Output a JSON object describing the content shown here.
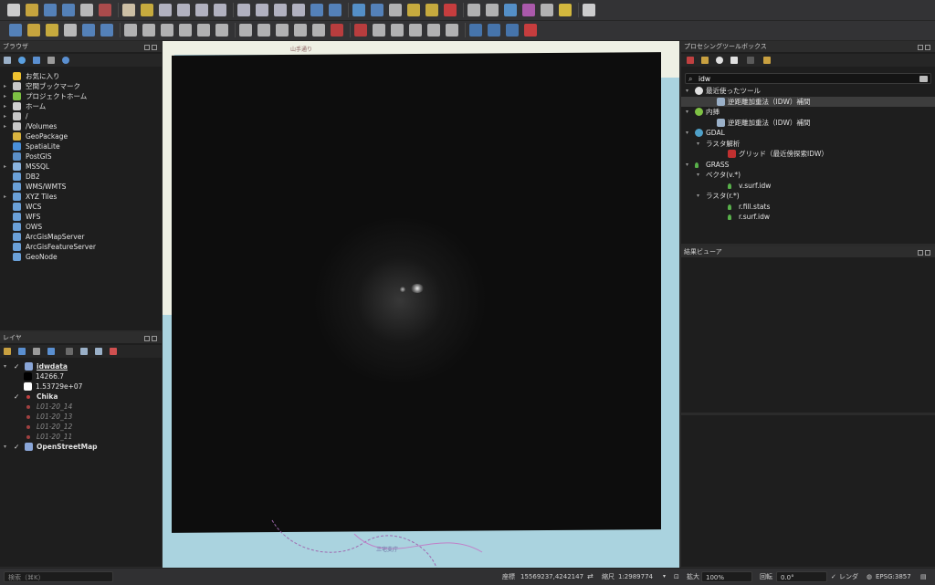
{
  "browser": {
    "title": "ブラウザ",
    "items": [
      {
        "label": "お気に入り",
        "icon": "star-icon",
        "color": "#f0c330",
        "arrow": ""
      },
      {
        "label": "空間ブックマーク",
        "icon": "bookmark-icon",
        "color": "#c8c8c8",
        "arrow": "▸"
      },
      {
        "label": "プロジェクトホーム",
        "icon": "project-home-icon",
        "color": "#7ec144",
        "arrow": "▸"
      },
      {
        "label": "ホーム",
        "icon": "home-icon",
        "color": "#d0d0d0",
        "arrow": "▸"
      },
      {
        "label": "/",
        "icon": "folder-icon",
        "color": "#c8c8c8",
        "arrow": "▸"
      },
      {
        "label": "/Volumes",
        "icon": "folder-icon",
        "color": "#c8c8c8",
        "arrow": "▸"
      },
      {
        "label": "GeoPackage",
        "icon": "geopackage-icon",
        "color": "#d9b440",
        "arrow": ""
      },
      {
        "label": "SpatiaLite",
        "icon": "spatialite-icon",
        "color": "#4a90d9",
        "arrow": ""
      },
      {
        "label": "PostGIS",
        "icon": "postgis-icon",
        "color": "#5b8fc7",
        "arrow": ""
      },
      {
        "label": "MSSQL",
        "icon": "mssql-icon",
        "color": "#8ab4e0",
        "arrow": "▸"
      },
      {
        "label": "DB2",
        "icon": "db2-icon",
        "color": "#6aa0d8",
        "arrow": ""
      },
      {
        "label": "WMS/WMTS",
        "icon": "wms-icon",
        "color": "#6aa0d8",
        "arrow": ""
      },
      {
        "label": "XYZ Tiles",
        "icon": "xyz-tiles-icon",
        "color": "#6aa0d8",
        "arrow": "▸"
      },
      {
        "label": "WCS",
        "icon": "wcs-icon",
        "color": "#6aa0d8",
        "arrow": ""
      },
      {
        "label": "WFS",
        "icon": "wfs-icon",
        "color": "#6aa0d8",
        "arrow": ""
      },
      {
        "label": "OWS",
        "icon": "ows-icon",
        "color": "#6aa0d8",
        "arrow": ""
      },
      {
        "label": "ArcGisMapServer",
        "icon": "arcgis-map-icon",
        "color": "#6aa0d8",
        "arrow": ""
      },
      {
        "label": "ArcGisFeatureServer",
        "icon": "arcgis-feature-icon",
        "color": "#6aa0d8",
        "arrow": ""
      },
      {
        "label": "GeoNode",
        "icon": "geonode-icon",
        "color": "#6aa0d8",
        "arrow": ""
      }
    ]
  },
  "layers": {
    "title": "レイヤ",
    "items": [
      {
        "label": "idwdata",
        "check": "✓",
        "arrow": "▾",
        "icon": "raster-layer-icon",
        "color": "#8aa6d8",
        "style": "bold-underline",
        "indent": 0
      },
      {
        "label": "14266.7",
        "check": "",
        "arrow": "",
        "icon": "black-swatch",
        "color": "#000000",
        "style": "normal",
        "indent": 1
      },
      {
        "label": "1.53729e+07",
        "check": "",
        "arrow": "",
        "icon": "white-swatch",
        "color": "#ffffff",
        "style": "normal",
        "indent": 1
      },
      {
        "label": "Chika",
        "check": "✓",
        "arrow": "",
        "icon": "point-layer-icon",
        "color": "#c04040",
        "style": "bold",
        "indent": 0
      },
      {
        "label": "L01-20_14",
        "check": "",
        "arrow": "",
        "icon": "point-layer-icon",
        "color": "#a04040",
        "style": "dim",
        "indent": 0
      },
      {
        "label": "L01-20_13",
        "check": "",
        "arrow": "",
        "icon": "point-layer-icon",
        "color": "#a04040",
        "style": "dim",
        "indent": 0
      },
      {
        "label": "L01-20_12",
        "check": "",
        "arrow": "",
        "icon": "point-layer-icon",
        "color": "#a04040",
        "style": "dim",
        "indent": 0
      },
      {
        "label": "L01-20_11",
        "check": "",
        "arrow": "",
        "icon": "point-layer-icon",
        "color": "#a04040",
        "style": "dim",
        "indent": 0
      },
      {
        "label": "OpenStreetMap",
        "check": "✓",
        "arrow": "▾",
        "icon": "xyz-tiles-icon",
        "color": "#8aa6d8",
        "style": "bold",
        "indent": 0
      }
    ]
  },
  "processing": {
    "title": "プロセシングツールボックス",
    "search_value": "idw",
    "tree": [
      {
        "label": "最近使ったツール",
        "arrow": "▾",
        "icon": "clock-icon",
        "color": "#e0e0e0",
        "indent": 0,
        "selected": false
      },
      {
        "label": "逆距離加重法（IDW）補間",
        "arrow": "",
        "icon": "idw-tool-icon",
        "color": "#9ab0c8",
        "indent": 2,
        "selected": true
      },
      {
        "label": "内挿",
        "arrow": "▾",
        "icon": "qgis-icon",
        "color": "#7ec144",
        "indent": 0,
        "selected": false
      },
      {
        "label": "逆距離加重法（IDW）補間",
        "arrow": "",
        "icon": "idw-tool-icon",
        "color": "#9ab0c8",
        "indent": 2,
        "selected": false
      },
      {
        "label": "GDAL",
        "arrow": "▾",
        "icon": "gdal-icon",
        "color": "#4fa0c8",
        "indent": 0,
        "selected": false
      },
      {
        "label": "ラスタ解析",
        "arrow": "▾",
        "icon": "",
        "color": "",
        "indent": 1,
        "selected": false
      },
      {
        "label": "グリッド（最近傍探索IDW）",
        "arrow": "",
        "icon": "gdal-grid-icon",
        "color": "#c03030",
        "indent": 3,
        "selected": false
      },
      {
        "label": "GRASS",
        "arrow": "▾",
        "icon": "grass-icon",
        "color": "#58b04a",
        "indent": 0,
        "selected": false
      },
      {
        "label": "ベクタ(v.*)",
        "arrow": "▾",
        "icon": "",
        "color": "",
        "indent": 1,
        "selected": false
      },
      {
        "label": "v.surf.idw",
        "arrow": "",
        "icon": "grass-icon",
        "color": "#58b04a",
        "indent": 3,
        "selected": false
      },
      {
        "label": "ラスタ(r.*)",
        "arrow": "▾",
        "icon": "",
        "color": "",
        "indent": 1,
        "selected": false
      },
      {
        "label": "r.fill.stats",
        "arrow": "",
        "icon": "grass-icon",
        "color": "#58b04a",
        "indent": 3,
        "selected": false
      },
      {
        "label": "r.surf.idw",
        "arrow": "",
        "icon": "grass-icon",
        "color": "#58b04a",
        "indent": 3,
        "selected": false
      }
    ]
  },
  "results": {
    "title": "結果ビューア"
  },
  "map": {
    "labels": {
      "top": "山手通り",
      "bottom": "三宅支庁"
    }
  },
  "statusbar": {
    "search_placeholder": "検索（⌘K）",
    "coordinate_label": "座標",
    "coordinate_value": "15569237,4242147",
    "scale_label": "縮尺",
    "scale_value": "1:2989774",
    "magnifier_label": "拡大",
    "magnifier_value": "100%",
    "rotation_label": "回転",
    "rotation_value": "0.0°",
    "render_label": "レンダ",
    "crs_label": "EPSG:3857"
  },
  "toolbar": {
    "row1_icons": [
      {
        "name": "new-project-icon",
        "color": "#e8e8e8"
      },
      {
        "name": "open-project-icon",
        "color": "#e0b840"
      },
      {
        "name": "save-project-icon",
        "color": "#5a8fd0"
      },
      {
        "name": "save-as-icon",
        "color": "#5a8fd0"
      },
      {
        "name": "print-layout-icon",
        "color": "#d0d0d0"
      },
      {
        "name": "style-manager-icon",
        "color": "#c05050"
      },
      {
        "name": "pan-icon",
        "color": "#e8d8b8"
      },
      {
        "name": "pan-to-selection-icon",
        "color": "#e0c040"
      },
      {
        "name": "zoom-in-icon",
        "color": "#c8c8d8"
      },
      {
        "name": "zoom-out-icon",
        "color": "#c8c8d8"
      },
      {
        "name": "zoom-full-icon",
        "color": "#c8c8d8"
      },
      {
        "name": "zoom-selection-icon",
        "color": "#c8c8d8"
      },
      {
        "name": "zoom-layer-icon",
        "color": "#c8c8d8"
      },
      {
        "name": "zoom-native-icon",
        "color": "#c8c8d8"
      },
      {
        "name": "zoom-last-icon",
        "color": "#c8c8d8"
      },
      {
        "name": "zoom-next-icon",
        "color": "#c8c8d8"
      },
      {
        "name": "new-map-view-icon",
        "color": "#5a8fd0"
      },
      {
        "name": "temporal-icon",
        "color": "#5a8fd0"
      },
      {
        "name": "refresh-icon",
        "color": "#5aa0e0"
      },
      {
        "name": "identify-icon",
        "color": "#5a8fd0"
      },
      {
        "name": "actions-icon",
        "color": "#c8c8c8"
      },
      {
        "name": "select-features-icon",
        "color": "#e0c040"
      },
      {
        "name": "select-value-icon",
        "color": "#e0c040"
      },
      {
        "name": "deselect-icon",
        "color": "#e04040"
      },
      {
        "name": "attribute-table-icon",
        "color": "#c8c8c8"
      },
      {
        "name": "field-calc-icon",
        "color": "#c8c8c8"
      },
      {
        "name": "processing-gear-icon",
        "color": "#5aa0e0"
      },
      {
        "name": "statistics-icon",
        "color": "#c060c0"
      },
      {
        "name": "measure-icon",
        "color": "#c8c8c8"
      },
      {
        "name": "map-tips-icon",
        "color": "#f0d040"
      },
      {
        "name": "text-annotation-icon",
        "color": "#e8e8e8"
      }
    ],
    "row2_icons": [
      {
        "name": "data-source-manager-icon",
        "color": "#5a8fd0"
      },
      {
        "name": "new-layer-icon",
        "color": "#e0b840"
      },
      {
        "name": "digitize-icon",
        "color": "#e0c040"
      },
      {
        "name": "virtual-layer-icon",
        "color": "#d0d0d0"
      },
      {
        "name": "temp-layer-icon",
        "color": "#5a8fd0"
      },
      {
        "name": "vector-icon",
        "color": "#5a8fd0"
      },
      {
        "name": "edit-pencil-icon",
        "color": "#c8c8c8"
      },
      {
        "name": "save-edits-icon",
        "color": "#c8c8c8"
      },
      {
        "name": "add-feature-icon",
        "color": "#c8c8c8"
      },
      {
        "name": "vertex-tool-icon",
        "color": "#c8c8c8"
      },
      {
        "name": "delete-icon",
        "color": "#c8c8c8"
      },
      {
        "name": "cut-icon",
        "color": "#c8c8c8"
      },
      {
        "name": "copy-icon",
        "color": "#c8c8c8"
      },
      {
        "name": "paste-icon",
        "color": "#c8c8c8"
      },
      {
        "name": "undo-icon",
        "color": "#c8c8c8"
      },
      {
        "name": "redo-icon",
        "color": "#c8c8c8"
      },
      {
        "name": "label-tool-icon",
        "color": "#c8c8c8"
      },
      {
        "name": "label-abc-icon",
        "color": "#d04040"
      },
      {
        "name": "label-abc2-icon",
        "color": "#d04040"
      },
      {
        "name": "pin-label-icon",
        "color": "#c8c8c8"
      },
      {
        "name": "show-hide-labels-icon",
        "color": "#c8c8c8"
      },
      {
        "name": "move-label-icon",
        "color": "#c8c8c8"
      },
      {
        "name": "rotate-label-icon",
        "color": "#c8c8c8"
      },
      {
        "name": "change-label-icon",
        "color": "#c8c8c8"
      },
      {
        "name": "python-icon",
        "color": "#4a80c0"
      },
      {
        "name": "plugin-icon",
        "color": "#4a80c0"
      },
      {
        "name": "help-icon",
        "color": "#4a80c0"
      },
      {
        "name": "record-icon",
        "color": "#e04040"
      }
    ]
  }
}
